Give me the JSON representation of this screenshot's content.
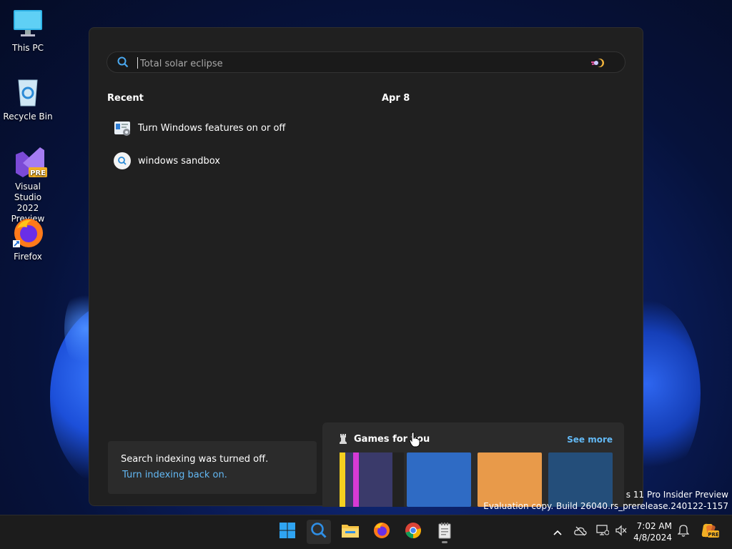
{
  "desktop": {
    "icons": [
      {
        "label": "This PC",
        "icon": "monitor-icon"
      },
      {
        "label": "Recycle Bin",
        "icon": "recycle-bin-icon"
      },
      {
        "label_line1": "Visual Studio",
        "label_line2": "2022 Preview",
        "badge": "PRE",
        "icon": "visual-studio-icon"
      },
      {
        "label": "Firefox",
        "icon": "firefox-icon"
      }
    ]
  },
  "search": {
    "placeholder": "Total solar eclipse",
    "value": ""
  },
  "recent": {
    "heading": "Recent",
    "items": [
      {
        "label": "Turn Windows features on or off",
        "icon": "windows-features-icon"
      },
      {
        "label": "windows sandbox",
        "icon": "search-history-icon"
      }
    ]
  },
  "today": {
    "heading": "Apr 8"
  },
  "indexing": {
    "message": "Search indexing was turned off.",
    "link": "Turn indexing back on."
  },
  "games": {
    "title": "Games for you",
    "see_more": "See more",
    "tiles": [
      {
        "color": "#3a3a6a"
      },
      {
        "color": "#2f6bc4"
      },
      {
        "color": "#e89a4a"
      },
      {
        "color": "#244e7a"
      }
    ]
  },
  "watermark": {
    "line1": "s 11 Pro Insider Preview",
    "line2": "Evaluation copy. Build 26040.rs_prerelease.240122-1157"
  },
  "taskbar": {
    "apps": [
      "start-icon",
      "search-icon",
      "file-explorer-icon",
      "firefox-icon",
      "chrome-icon",
      "notepad-icon"
    ],
    "clock_time": "7:02 AM",
    "clock_date": "4/8/2024",
    "copilot_badge": "PRE"
  },
  "colors": {
    "accent": "#63b9f5",
    "panel": "#202020",
    "card": "#2b2b2b"
  }
}
